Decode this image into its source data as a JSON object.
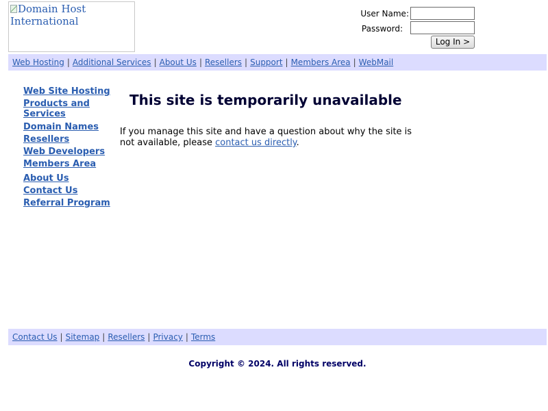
{
  "logo": {
    "alt_text": "Domain Host International"
  },
  "login": {
    "username_label": "User Name:",
    "password_label": "Password:",
    "username_value": "",
    "password_value": "",
    "button_label": "Log In >"
  },
  "topnav": {
    "items": [
      "Web Hosting",
      "Additional Services",
      "About Us",
      "Resellers",
      "Support",
      "Members Area",
      "WebMail"
    ],
    "separator": "|"
  },
  "sidebar": {
    "items": [
      "Web Site Hosting",
      "Products and Services",
      "Domain Names",
      "Resellers",
      "Web Developers",
      "Members Area",
      "About Us",
      "Contact Us",
      "Referral Program"
    ]
  },
  "main": {
    "title": "This site is temporarily unavailable",
    "message_before": "If you manage this site and have a question about why the site is not available, please ",
    "message_link": "contact us directly",
    "message_after": "."
  },
  "footnav": {
    "items": [
      "Contact Us",
      "Sitemap",
      "Resellers",
      "Privacy",
      "Terms"
    ],
    "separator": "|"
  },
  "footer": {
    "copyright": "Copyright © 2024. All rights reserved."
  },
  "colors": {
    "link": "#2a5db0",
    "bar_bg": "#dcdcff",
    "title": "#000033",
    "copyright": "#000066"
  }
}
